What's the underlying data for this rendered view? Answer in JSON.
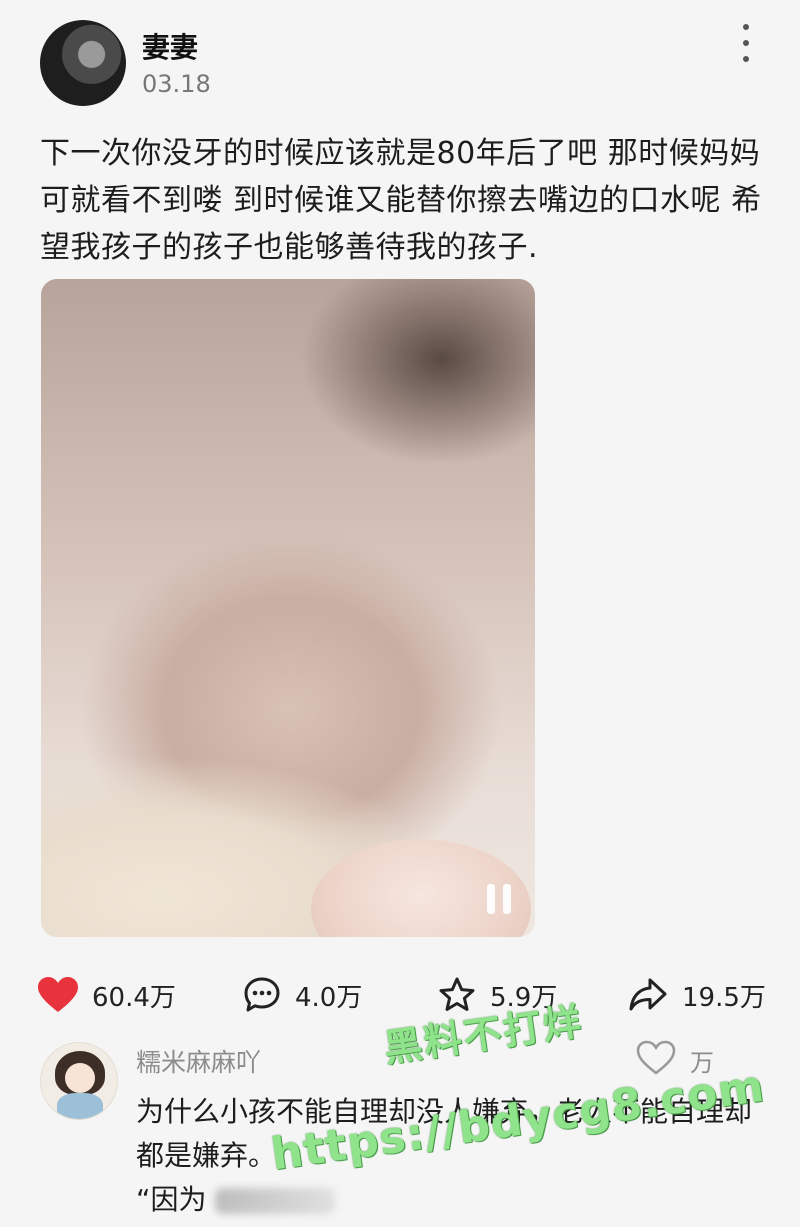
{
  "post": {
    "author": "妻妻",
    "date": "03.18",
    "text": "下一次你没牙的时候应该就是80年后了吧 那时候妈妈可就看不到喽 到时候谁又能替你擦去嘴边的口水呢 希望我孩子的孩子也能够善待我的孩子.",
    "more_icon": "more-vertical-icon"
  },
  "media": {
    "type": "video",
    "state_icon": "pause-icon"
  },
  "actions": {
    "like": {
      "icon": "heart-icon",
      "count": "60.4万",
      "color": "#e8323c"
    },
    "comment": {
      "icon": "comment-icon",
      "count": "4.0万"
    },
    "favorite": {
      "icon": "star-icon",
      "count": "5.9万"
    },
    "share": {
      "icon": "share-icon",
      "count": "19.5万"
    }
  },
  "comment": {
    "user": "糯米麻麻吖",
    "like_icon": "heart-outline-icon",
    "like_count": "万",
    "text": "为什么小孩不能自理却没人嫌弃，老人不能自理却都是嫌弃。",
    "text_line3": "“因为"
  },
  "watermark": {
    "line1": "黑料不打烊",
    "line2": "https://bdycg8.com",
    "color": "#8fe38a"
  }
}
